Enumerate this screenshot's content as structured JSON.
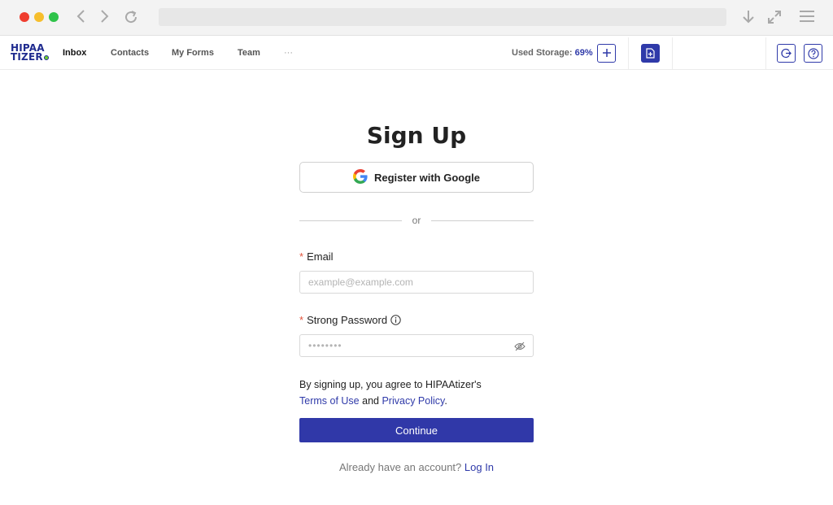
{
  "browser": {
    "icons": [
      "back-icon",
      "forward-icon",
      "reload-icon",
      "download-icon",
      "fullscreen-icon",
      "menu-icon"
    ]
  },
  "app": {
    "logo_line1": "HIPAA",
    "logo_line2": "TIZER",
    "nav": {
      "inbox": "Inbox",
      "contacts": "Contacts",
      "my_forms": "My Forms",
      "team": "Team",
      "more": "···"
    },
    "storage_label": "Used Storage:",
    "storage_value": "69%",
    "accent": "#2f3aa9"
  },
  "form": {
    "title": "Sign Up",
    "google_label": "Register with Google",
    "or": "or",
    "email_required": "*",
    "email_label": "Email",
    "email_placeholder": "example@example.com",
    "password_required": "*",
    "password_label": "Strong Password",
    "password_value": "••••••••",
    "terms_prefix": "By signing up, you agree to HIPAAtizer's",
    "terms_link": "Terms of Use",
    "terms_and": "and",
    "privacy_link": "Privacy Policy",
    "terms_suffix": ".",
    "continue_label": "Continue",
    "already_text": "Already have an account?",
    "login_link": "Log In"
  }
}
